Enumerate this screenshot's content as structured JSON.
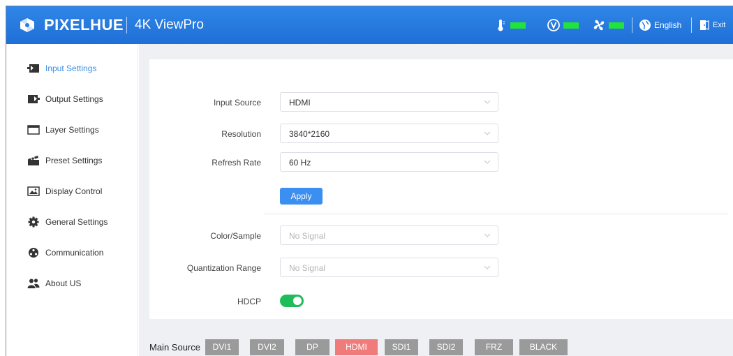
{
  "header": {
    "brand": "PIXELHUE",
    "product": "4K ViewPro",
    "language_label": "English",
    "exit_label": "Exit",
    "status_led_color": "#22e33a",
    "status_icons": [
      "thermometer-icon",
      "voltage-icon",
      "fan-icon"
    ]
  },
  "sidebar": {
    "items": [
      {
        "label": "Input Settings",
        "icon": "input-icon",
        "active": true
      },
      {
        "label": "Output Settings",
        "icon": "output-icon",
        "active": false
      },
      {
        "label": "Layer Settings",
        "icon": "layer-icon",
        "active": false
      },
      {
        "label": "Preset Settings",
        "icon": "preset-icon",
        "active": false
      },
      {
        "label": "Display Control",
        "icon": "display-icon",
        "active": false
      },
      {
        "label": "General Settings",
        "icon": "gear-icon",
        "active": false
      },
      {
        "label": "Communication",
        "icon": "communication-icon",
        "active": false
      },
      {
        "label": "About US",
        "icon": "users-icon",
        "active": false
      }
    ],
    "active_color": "#3a8ee6"
  },
  "form": {
    "input_source": {
      "label": "Input Source",
      "value": "HDMI"
    },
    "resolution": {
      "label": "Resolution",
      "value": "3840*2160"
    },
    "refresh_rate": {
      "label": "Refresh Rate",
      "value": "60 Hz"
    },
    "apply_label": "Apply",
    "color_sample": {
      "label": "Color/Sample",
      "value": "No Signal"
    },
    "quantization_range": {
      "label": "Quantization Range",
      "value": "No Signal"
    },
    "hdcp": {
      "label": "HDCP",
      "enabled": true
    }
  },
  "source_bar": {
    "label": "Main Source",
    "buttons": [
      {
        "label": "DVI1",
        "active": false
      },
      {
        "label": "DVI2",
        "active": false
      },
      {
        "label": "DP",
        "active": false
      },
      {
        "label": "HDMI",
        "active": true
      },
      {
        "label": "SDI1",
        "active": false
      },
      {
        "label": "SDI2",
        "active": false
      },
      {
        "label": "FRZ",
        "active": false
      },
      {
        "label": "BLACK",
        "active": false
      }
    ],
    "active_color": "#f07b7b"
  }
}
